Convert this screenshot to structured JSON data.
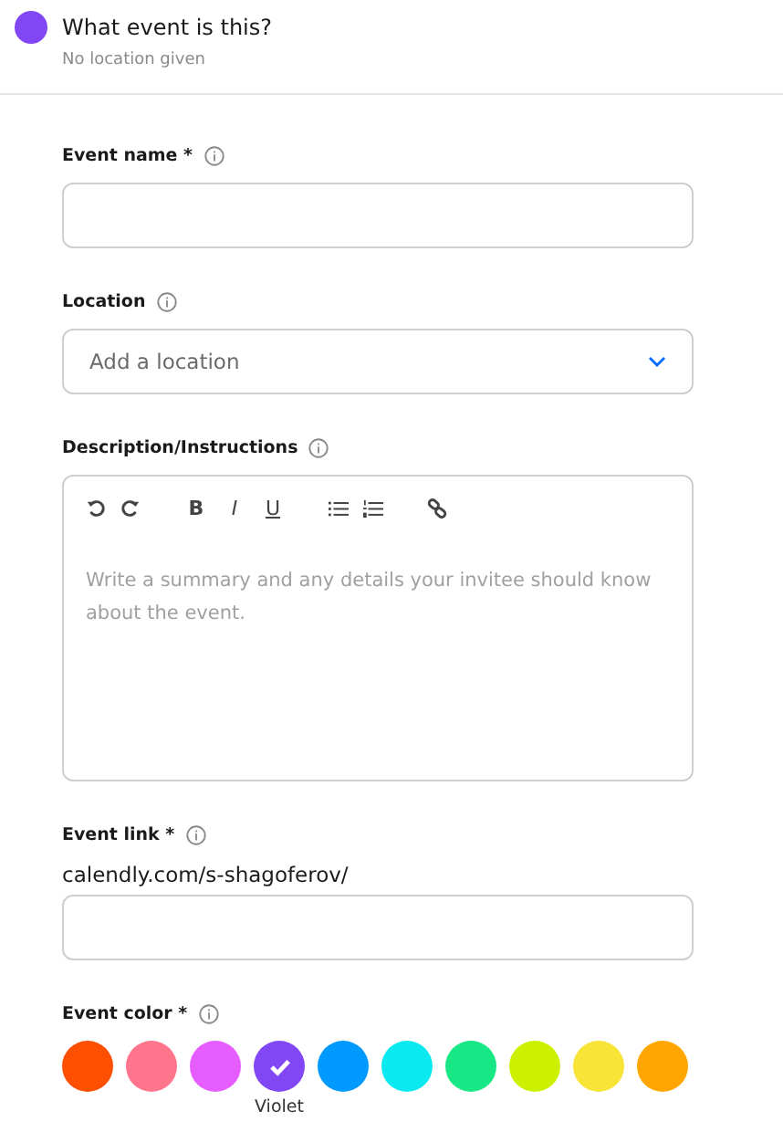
{
  "header": {
    "title": "What event is this?",
    "subtitle": "No location given"
  },
  "event_name": {
    "label": "Event name *"
  },
  "location": {
    "label": "Location",
    "placeholder": "Add a location"
  },
  "description": {
    "label": "Description/Instructions",
    "format_buttons": [
      "B",
      "I",
      "U"
    ],
    "placeholder": "Write a summary and any details your invitee should know about the event."
  },
  "event_link": {
    "label": "Event link *",
    "prefix": "calendly.com/s-shagoferov/"
  },
  "event_color": {
    "label": "Event color *",
    "colors": [
      {
        "color": "#ff4f00",
        "selected": false
      },
      {
        "color": "#ff758c",
        "selected": false
      },
      {
        "color": "#e55cff",
        "selected": false
      },
      {
        "color": "#8247f5",
        "selected": true,
        "name": "Violet"
      },
      {
        "color": "#0099ff",
        "selected": false
      },
      {
        "color": "#0ae8f0",
        "selected": false
      },
      {
        "color": "#17e885",
        "selected": false
      },
      {
        "color": "#ccf000",
        "selected": false
      },
      {
        "color": "#f8e436",
        "selected": false
      },
      {
        "color": "#ffa600",
        "selected": false
      }
    ]
  }
}
